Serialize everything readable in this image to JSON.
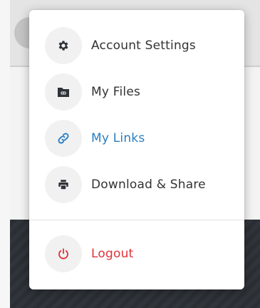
{
  "colors": {
    "default_text": "#333333",
    "active": "#2a7dc1",
    "danger": "#e0313a",
    "icon_default": "#2f3338"
  },
  "menu": {
    "items": [
      {
        "label": "Account Settings",
        "icon": "gear-icon"
      },
      {
        "label": "My Files",
        "icon": "folder-icon"
      },
      {
        "label": "My Links",
        "icon": "link-icon",
        "active": true
      },
      {
        "label": "Download & Share",
        "icon": "printer-icon"
      }
    ],
    "logout": {
      "label": "Logout",
      "icon": "power-icon"
    }
  }
}
